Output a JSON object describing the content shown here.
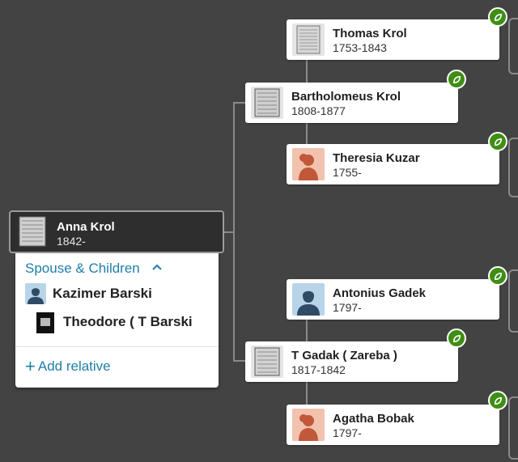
{
  "focus_person": {
    "name": "Anna Krol",
    "dates": "1842-"
  },
  "panel": {
    "section_label": "Spouse & Children",
    "spouse": {
      "name": "Kazimer Barski"
    },
    "child": {
      "name": "Theodore ( T Barski"
    },
    "add_label": "Add relative"
  },
  "parents": {
    "father": {
      "name": "Bartholomeus Krol",
      "dates": "1808-1877"
    },
    "mother": {
      "name": "T Gadak ( Zareba )",
      "dates": "1817-1842"
    }
  },
  "grandparents": {
    "paternal_grandfather": {
      "name": "Thomas Krol",
      "dates": "1753-1843"
    },
    "paternal_grandmother": {
      "name": "Theresia Kuzar",
      "dates": "1755-"
    },
    "maternal_grandfather": {
      "name": "Antonius Gadek",
      "dates": "1797-"
    },
    "maternal_grandmother": {
      "name": "Agatha Bobak",
      "dates": "1797-"
    }
  },
  "colors": {
    "background": "#434343",
    "hint_leaf": "#3e8e13",
    "link": "#1f7ea8",
    "female_avatar": "#f2c2ae",
    "male_avatar": "#b9d4e8"
  }
}
